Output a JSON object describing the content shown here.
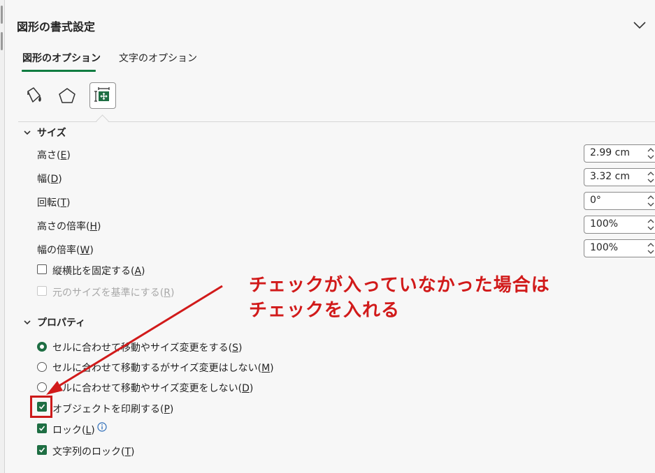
{
  "pane": {
    "title": "図形の書式設定"
  },
  "tabs": [
    {
      "label": "図形のオプション",
      "active": true
    },
    {
      "label": "文字のオプション",
      "active": false
    }
  ],
  "toolbar": {
    "icons": [
      "fill-line-icon",
      "effects-pentagon-icon",
      "size-properties-icon"
    ],
    "selected": "size-properties-icon"
  },
  "size": {
    "header": "サイズ",
    "height": {
      "label": "高さ",
      "key": "E",
      "value": "2.99 cm"
    },
    "width": {
      "label": "幅",
      "key": "D",
      "value": "3.32 cm"
    },
    "rotation": {
      "label": "回転",
      "key": "T",
      "value": "0°"
    },
    "scale_height": {
      "label": "高さの倍率",
      "key": "H",
      "value": "100%"
    },
    "scale_width": {
      "label": "幅の倍率",
      "key": "W",
      "value": "100%"
    },
    "lock_aspect": {
      "label": "縦横比を固定する",
      "key": "A",
      "checked": false
    },
    "relative_original": {
      "label": "元のサイズを基準にする",
      "key": "R",
      "checked": false,
      "disabled": true
    }
  },
  "properties": {
    "header": "プロパティ",
    "radio1": {
      "label": "セルに合わせて移動やサイズ変更をする",
      "key": "S",
      "selected": true
    },
    "radio2": {
      "label": "セルに合わせて移動するがサイズ変更はしない",
      "key": "M",
      "selected": false
    },
    "radio3": {
      "label": "セルに合わせて移動やサイズ変更をしない",
      "key": "D",
      "selected": false
    },
    "print_object": {
      "label": "オブジェクトを印刷する",
      "key": "P",
      "checked": true
    },
    "locked": {
      "label": "ロック",
      "key": "L",
      "checked": true
    },
    "lock_text": {
      "label": "文字列のロック",
      "key": "T",
      "checked": true
    }
  },
  "annotation": {
    "line1": "チェックが入っていなかった場合は",
    "line2": "チェックを入れる",
    "color": "#d11a1a"
  },
  "colors": {
    "accent": "#107c41",
    "checkbox": "#1e6e43"
  }
}
